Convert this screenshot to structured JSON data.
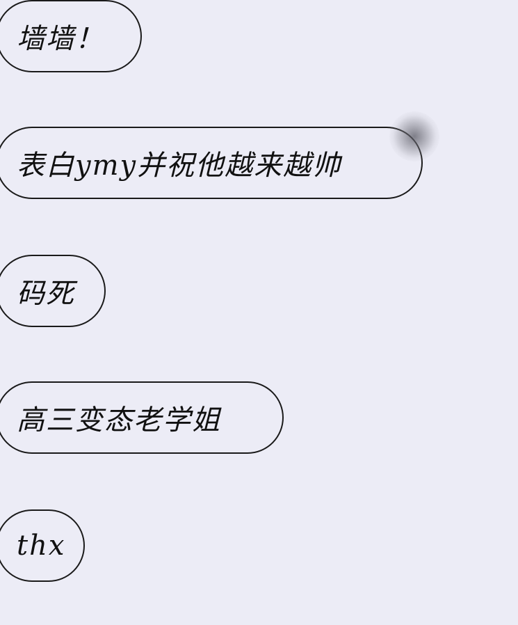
{
  "messages": [
    {
      "text": "墙墙！"
    },
    {
      "text": "表白ymy并祝他越来越帅"
    },
    {
      "text": "码死"
    },
    {
      "text": "高三变态老学姐"
    },
    {
      "text": "thx"
    }
  ],
  "colors": {
    "background": "#ececf6",
    "bubble_border": "#1a1a1a",
    "text": "#111111"
  }
}
